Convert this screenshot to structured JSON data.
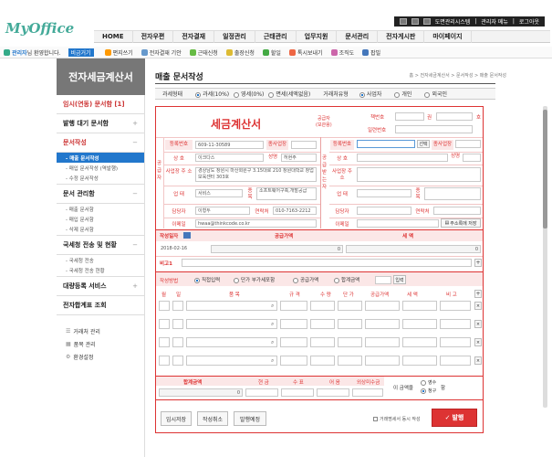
{
  "app": {
    "logo_my": "My",
    "logo_office": "Office"
  },
  "util": [
    "도면관리시스템",
    "관리자 메뉴",
    "로그아웃"
  ],
  "mainnav": [
    "HOME",
    "전자우편",
    "전자결재",
    "일정관리",
    "근태관리",
    "업무지원",
    "문서관리",
    "전자게시판",
    "마이페이지"
  ],
  "subbar": {
    "user": "관리자",
    "welcome": "님 환영합니다.",
    "badge": "비금거기",
    "items": [
      "편지쓰기",
      "전자결재 기안",
      "근태신청",
      "출장신청",
      "할일",
      "톡시보내기",
      "조직도",
      "팝빌"
    ]
  },
  "sidebar": {
    "header": "전자세금계산서",
    "sec1": "임시(연동) 문서함 [1]",
    "sec2": "발행 대기 문서함",
    "sec3": "문서작성",
    "sub3": [
      "- 매출 문서작성",
      "- 매입 문서작성 (역발행)",
      "- 수정 문서작성"
    ],
    "sec4": "문서 관리함",
    "sub4": [
      "- 매출 문서함",
      "- 매입 문서함",
      "- 삭제 문서함"
    ],
    "sec5": "국세청 전송 및 현황",
    "sub5": [
      "- 국세청 전송",
      "- 국세청 전송 현황"
    ],
    "sec6": "대량등록 서비스",
    "sec7": "전자합계표 조회",
    "tools": [
      "거래처 관리",
      "품목 관리",
      "환경설정"
    ]
  },
  "page": {
    "title": "매출 문서작성",
    "breadcrumb": "홈 > 전자세금계산서 > 문서작성 > 매출 문서작성"
  },
  "typerow": {
    "label1": "과세형태",
    "opts1": [
      "과세(10%)",
      "영세(0%)",
      "면세(세액없음)"
    ],
    "label2": "거래처유형",
    "opts2": [
      "사업자",
      "개인",
      "외국인"
    ]
  },
  "form": {
    "title": "세금계산서",
    "sub": "공급자\n(보관용)",
    "book_label": "책번호",
    "book_unit1": "권",
    "book_unit2": "호",
    "serial_label": "일련번호",
    "sup_label": "공급자",
    "recv_label": "공급받는자",
    "reg_no": "등록번호",
    "reg_value": "609-11-30589",
    "branch": "종사업장",
    "company": "상 호",
    "company_value": "이크다스",
    "name": "성명",
    "name_value": "허현주",
    "addr": "사업장 주 소",
    "addr_value": "경상남도 창원시 마산회원구 3.15대로 210 창원대학교 창업보육센터 303호",
    "biz": "업 태",
    "biz_value": "서비스",
    "item": "종목",
    "item_value": "소프트웨어구축,개발공급",
    "manager": "담당자",
    "manager_value": "이형두",
    "phone": "연락처",
    "phone_value": "010-7163-2212",
    "email": "이메일",
    "email_value": "hwaa@thinkcode.co.kr",
    "select_btn": "선택",
    "addrbook_btn": "주소록에 저장",
    "date_label": "작성일자",
    "date_value": "2018-02-16",
    "supply_label": "공급가액",
    "tax_label": "세 액",
    "supply_value": "0",
    "tax_value": "0",
    "remark_label": "비고1",
    "method_label": "작성방법",
    "methods": [
      "직접입력",
      "단가 부가세포함",
      "공급가액",
      "합계금액"
    ],
    "method_btn": "입력",
    "cols": [
      "월",
      "일",
      "품 목",
      "규 격",
      "수 량",
      "단 가",
      "공급가액",
      "세 액",
      "비 고"
    ],
    "total_labels": [
      "합계금액",
      "현 금",
      "수 표",
      "어 음",
      "외상미수금"
    ],
    "total_value": "0",
    "receipt_prefix": "이 금액을",
    "receipt_opts": [
      "영수",
      "청구"
    ],
    "receipt_suffix": "함",
    "btns": [
      "임시저장",
      "작성취소",
      "발행예정"
    ],
    "sms_label": "거래명세서 동시 작성",
    "issue_btn": "발행"
  }
}
